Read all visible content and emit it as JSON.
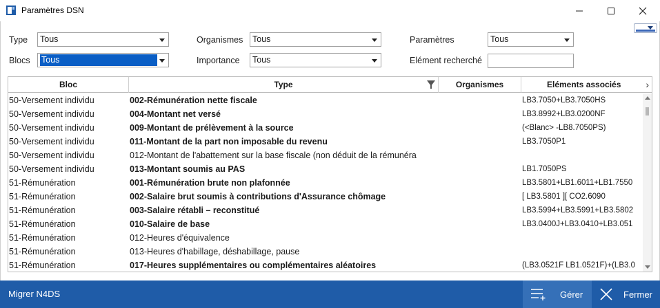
{
  "window": {
    "title": "Paramètres DSN"
  },
  "filters": {
    "type": {
      "label": "Type",
      "value": "Tous"
    },
    "blocs": {
      "label": "Blocs",
      "value": "Tous"
    },
    "organismes": {
      "label": "Organismes",
      "value": "Tous"
    },
    "importance": {
      "label": "Importance",
      "value": "Tous"
    },
    "parametres": {
      "label": "Paramètres",
      "value": "Tous"
    },
    "element_recherche": {
      "label": "Elément recherché",
      "value": ""
    }
  },
  "grid": {
    "columns": [
      "Bloc",
      "Type",
      "Organismes",
      "Eléments associés"
    ],
    "rows": [
      {
        "bloc": "50-Versement individu",
        "code": "002",
        "label": "-Rémunération nette fiscale",
        "organismes": "",
        "elements": "LB3.7050+LB3.7050HS",
        "bold": true
      },
      {
        "bloc": "50-Versement individu",
        "code": "004",
        "label": "-Montant net versé",
        "organismes": "",
        "elements": "LB3.8992+LB3.0200NF",
        "bold": true
      },
      {
        "bloc": "50-Versement individu",
        "code": "009",
        "label": "-Montant de prélèvement à la source",
        "organismes": "",
        "elements": "(<Blanc> -LB8.7050PS)",
        "bold": true
      },
      {
        "bloc": "50-Versement individu",
        "code": "011",
        "label": "-Montant de la part non imposable du revenu",
        "organismes": "",
        "elements": "LB3.7050P1",
        "bold": true
      },
      {
        "bloc": "50-Versement individu",
        "code": "012",
        "label": "-Montant de l'abattement sur la base fiscale (non déduit de la  rémunéra",
        "organismes": "",
        "elements": "",
        "bold": false
      },
      {
        "bloc": "50-Versement individu",
        "code": "013",
        "label": "-Montant soumis au PAS",
        "organismes": "",
        "elements": "LB1.7050PS",
        "bold": true
      },
      {
        "bloc": "51-Rémunération",
        "code": "001",
        "label": "-Rémunération brute non plafonnée",
        "organismes": "",
        "elements": "LB3.5801+LB1.6011+LB1.7550",
        "bold": true
      },
      {
        "bloc": "51-Rémunération",
        "code": "002",
        "label": "-Salaire brut soumis à contributions d'Assurance chômage",
        "organismes": "",
        "elements": "[ LB3.5801 ][ CO2.6090",
        "bold": true
      },
      {
        "bloc": "51-Rémunération",
        "code": "003",
        "label": "-Salaire rétabli – reconstitué",
        "organismes": "",
        "elements": "LB3.5994+LB3.5991+LB3.5802",
        "bold": true
      },
      {
        "bloc": "51-Rémunération",
        "code": "010",
        "label": "-Salaire de base",
        "organismes": "",
        "elements": "LB3.0400J+LB3.0410+LB3.051",
        "bold": true
      },
      {
        "bloc": "51-Rémunération",
        "code": "012",
        "label": "-Heures d'équivalence",
        "organismes": "",
        "elements": "",
        "bold": false
      },
      {
        "bloc": "51-Rémunération",
        "code": "013",
        "label": "-Heures d'habillage, déshabillage, pause",
        "organismes": "",
        "elements": "",
        "bold": false
      },
      {
        "bloc": "51-Rémunération",
        "code": "017",
        "label": "-Heures supplémentaires ou complémentaires aléatoires",
        "organismes": "",
        "elements": "(LB3.0521F LB1.0521F)+(LB3.0",
        "bold": true
      }
    ]
  },
  "footer": {
    "migrate_label": "Migrer N4DS",
    "manage_label": "Gérer",
    "close_label": "Fermer"
  },
  "colors": {
    "accent": "#1f5ca8",
    "selection": "#0a5ec5"
  }
}
